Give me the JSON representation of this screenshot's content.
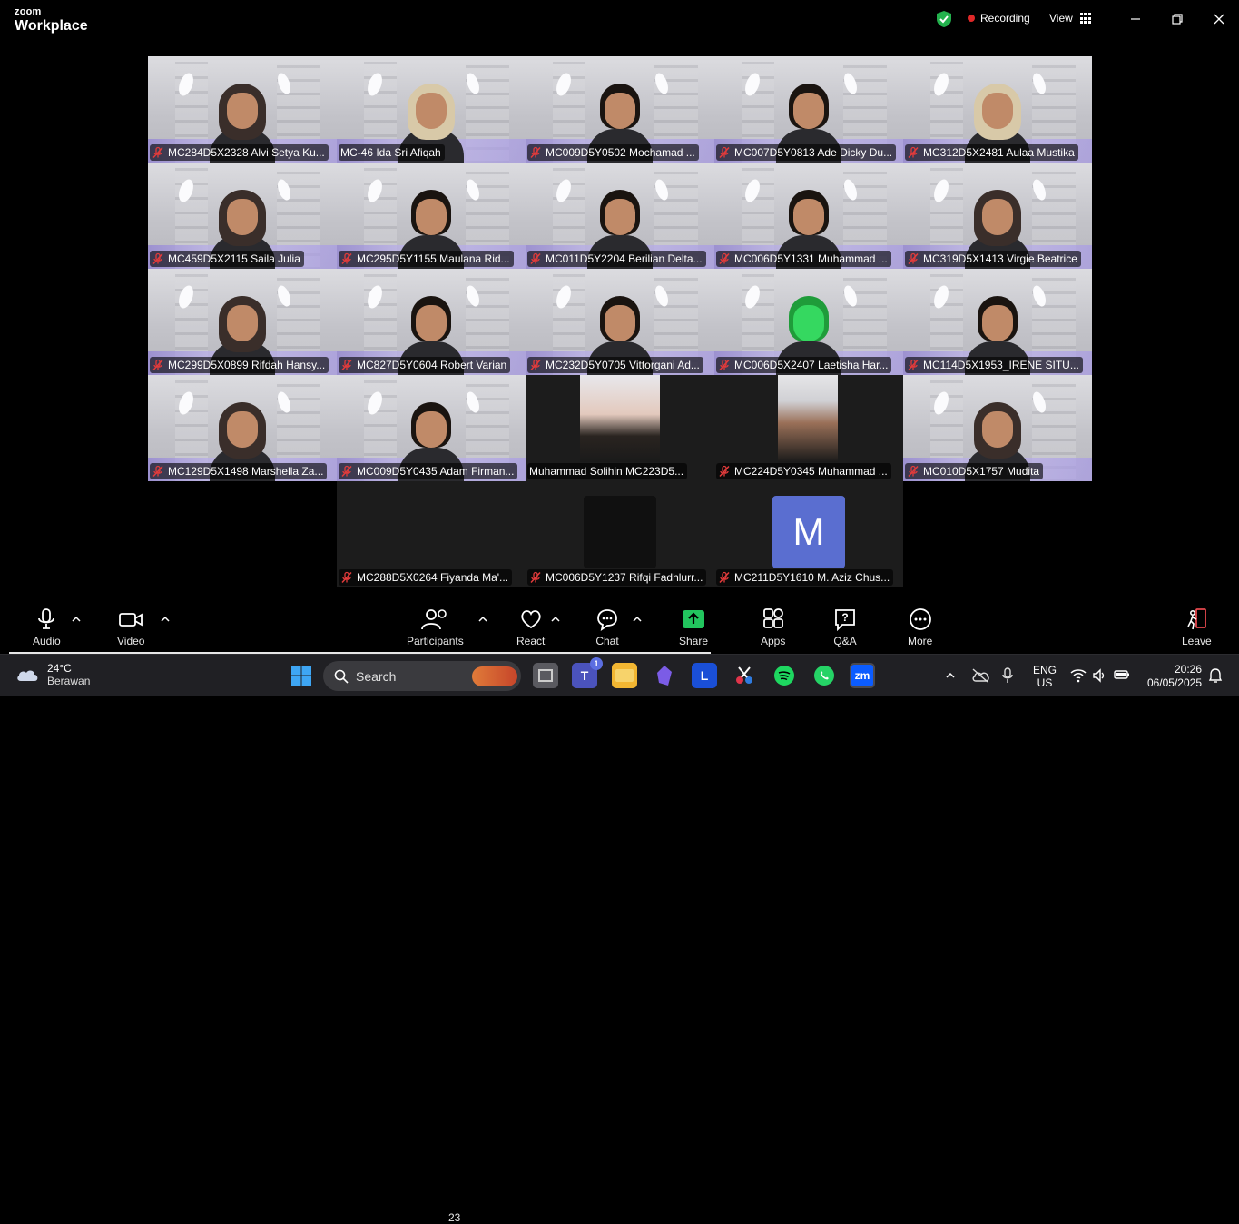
{
  "app": {
    "brand_top": "zoom",
    "brand_bottom": "Workplace",
    "recording_label": "Recording",
    "view_label": "View"
  },
  "participants": [
    {
      "name": "MC284D5X2328 Alvi Setya Ku...",
      "muted": true
    },
    {
      "name": "MC-46 Ida Sri Afiqah",
      "muted": false,
      "speaking": true
    },
    {
      "name": "MC009D5Y0502 Mochamad ...",
      "muted": true
    },
    {
      "name": "MC007D5Y0813 Ade Dicky Du...",
      "muted": true
    },
    {
      "name": "MC312D5X2481 Aulaa Mustika",
      "muted": true
    },
    {
      "name": "MC459D5X2115 Saila Julia",
      "muted": true
    },
    {
      "name": "MC295D5Y1155 Maulana Rid...",
      "muted": true
    },
    {
      "name": "MC011D5Y2204 Berilian Delta...",
      "muted": true
    },
    {
      "name": "MC006D5Y1331 Muhammad ...",
      "muted": true
    },
    {
      "name": "MC319D5X1413 Virgie Beatrice",
      "muted": true
    },
    {
      "name": "MC299D5X0899 Rifdah Hansy...",
      "muted": true
    },
    {
      "name": "MC827D5Y0604 Robert Varian",
      "muted": true
    },
    {
      "name": "MC232D5Y0705 Vittorgani Ad...",
      "muted": true
    },
    {
      "name": "MC006D5X2407 Laetisha Har...",
      "muted": true
    },
    {
      "name": "MC114D5X1953_IRENE SITU...",
      "muted": true
    },
    {
      "name": "MC129D5X1498 Marshella Za...",
      "muted": true
    },
    {
      "name": "MC009D5Y0435 Adam Firman...",
      "muted": true
    },
    {
      "name": "Muhammad Solihin MC223D5...",
      "muted": false
    },
    {
      "name": "MC224D5Y0345 Muhammad ...",
      "muted": true
    },
    {
      "name": "MC010D5X1757 Mudita",
      "muted": true
    },
    {
      "name": "MC288D5X0264 Fiyanda Ma'...",
      "muted": true
    },
    {
      "name": "MC006D5Y1237 Rifqi Fadhlurr...",
      "muted": true
    },
    {
      "name": "MC211D5Y1610 M. Aziz Chus...",
      "muted": true,
      "avatar_letter": "M"
    }
  ],
  "toolbar": {
    "audio": "Audio",
    "video": "Video",
    "participants": "Participants",
    "participants_count": "23",
    "react": "React",
    "chat": "Chat",
    "share": "Share",
    "apps": "Apps",
    "qa": "Q&A",
    "more": "More",
    "leave": "Leave"
  },
  "taskbar": {
    "temperature": "24°C",
    "weather": "Berawan",
    "search_label": "Search",
    "teams_badge": "1",
    "lang_top": "ENG",
    "lang_bottom": "US",
    "time": "20:26",
    "date": "06/05/2025"
  },
  "colors": {
    "speaking_border": "#2ed66b",
    "record_dot": "#e02828",
    "share_green": "#22c55e",
    "mute_red": "#e23b3b",
    "avatar_blue": "#5a6ed0",
    "leave_red": "#e5484d"
  }
}
